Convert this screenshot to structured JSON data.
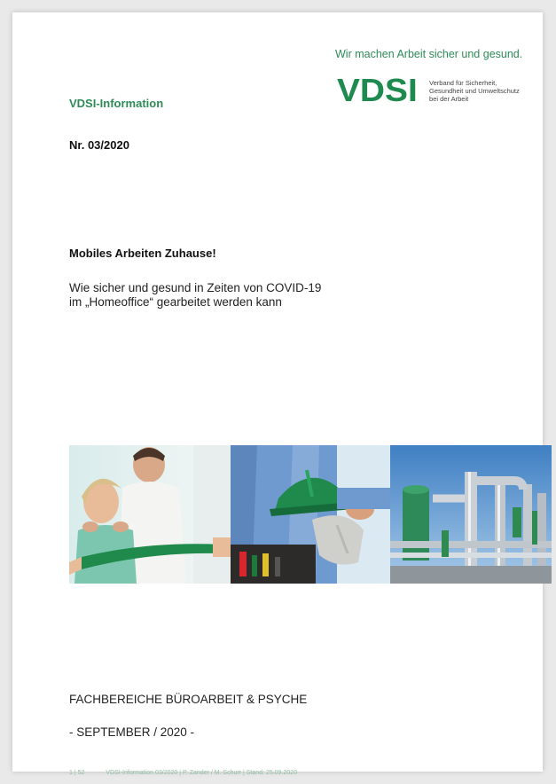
{
  "header": {
    "tagline": "Wir machen Arbeit sicher und gesund.",
    "logo_mark": "VDSI",
    "logo_lines": [
      "Verband für Sicherheit,",
      "Gesundheit und Umweltschutz",
      "bei der Arbeit"
    ],
    "series_label": "VDSI-Information"
  },
  "issue_number": "Nr. 03/2020",
  "headline": "Mobiles Arbeiten Zuhause!",
  "subtitle_lines": [
    "Wie sicher und gesund in Zeiten von COVID-19",
    "im „Homeoffice“ gearbeitet werden kann"
  ],
  "photos": [
    "physiotherapy-photo",
    "worker-helmet-photo",
    "industrial-pipes-photo"
  ],
  "departments": "FACHBEREICHE BÜROARBEIT & PSYCHE",
  "date_line": "- SEPTEMBER / 2020 -",
  "footer": {
    "page": "1 | 52",
    "info": "VDSI-Information 03/2020 | P. Zander / M. Schurr | Stand: 25.09.2020"
  },
  "colors": {
    "brand_green": "#1e8a4f",
    "label_green": "#2e8b57",
    "footer_green": "#8fbfa2"
  }
}
